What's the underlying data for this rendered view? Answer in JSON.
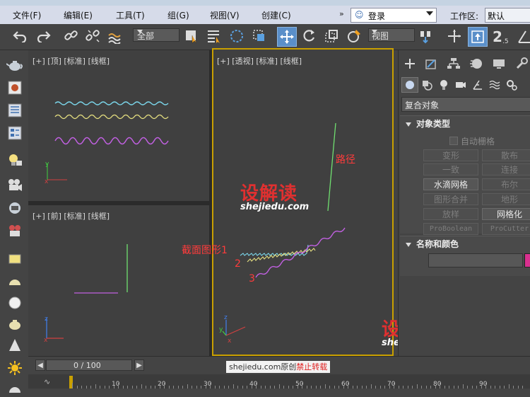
{
  "menu": {
    "items": [
      "文件(F)",
      "编辑(E)",
      "工具(T)",
      "组(G)",
      "视图(V)",
      "创建(C)"
    ],
    "more": "»",
    "login": "登录",
    "workspace_label": "工作区:",
    "workspace_value": "默认"
  },
  "toolbar": {
    "selection_filter": "全部",
    "ref_coord": "视图"
  },
  "viewports": {
    "top_label": "[+] [顶] [标准] [线框]",
    "front_label": "[+] [前] [标准] [线框]",
    "persp_label": "[+] [透视] [标准] [线框]"
  },
  "annotations": {
    "path": "路径",
    "section1": "截面图形1",
    "n2": "2",
    "n3": "3"
  },
  "watermark": {
    "brand": "设解读",
    "domain": "shejiedu.com"
  },
  "command_panel": {
    "category": "复合对象",
    "object_type": {
      "title": "对象类型",
      "autogrid": "自动栅格",
      "buttons": [
        "变形",
        "散布",
        "一致",
        "连接",
        "水滴网格",
        "布尔",
        "图形合并",
        "地形",
        "放样",
        "网格化",
        "ProBoolean",
        "ProCutter"
      ]
    },
    "name_color": {
      "title": "名称和颜色"
    },
    "colors": {
      "swatch": "#d9308f"
    }
  },
  "timeline": {
    "frame": "0 / 100",
    "ticks": [
      "10",
      "20",
      "30",
      "40",
      "50",
      "60",
      "70",
      "80",
      "90"
    ],
    "credit_main": "shejiedu.com原创",
    "credit_red": "禁止转载"
  },
  "colors": {
    "accent": "#5a8fc9",
    "active_viewport_border": "#c9a000",
    "annotation": "#ff3b3b"
  }
}
